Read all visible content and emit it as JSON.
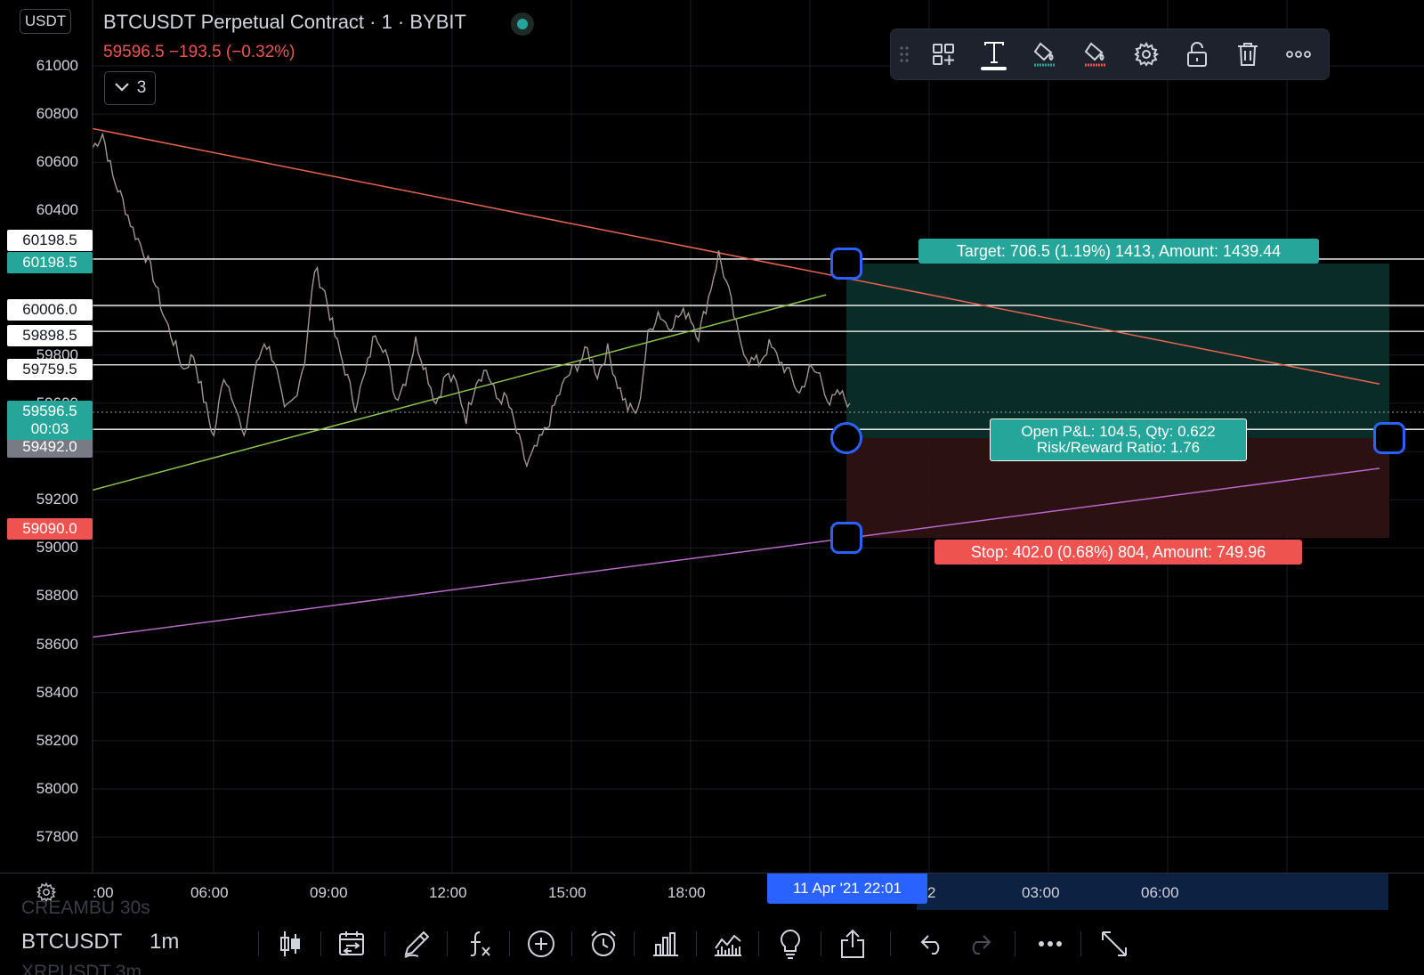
{
  "currency_badge": "USDT",
  "header": {
    "title": "BTCUSDT Perpetual Contract · 1 · BYBIT",
    "price_change": "59596.5 −193.5 (−0.32%)",
    "indicator_count": "3"
  },
  "colors": {
    "up": "#26a69a",
    "down": "#ef5350",
    "accent": "#2962ff",
    "background": "#000000",
    "toolbar_bg": "#1e222d"
  },
  "drawing_toolbar": {
    "icons": [
      "drag-grip-icon",
      "add-to-favorites-icon",
      "text-icon",
      "line-color-icon",
      "fill-color-icon",
      "settings-gear-icon",
      "unlock-icon",
      "trash-icon",
      "more-icon"
    ],
    "active": "text-icon"
  },
  "price_axis": {
    "ticks": [
      "61000",
      "60800",
      "60600",
      "60400",
      "60200",
      "60000",
      "59800",
      "59600",
      "59400",
      "59200",
      "59000",
      "58800",
      "58600",
      "58400",
      "58200",
      "58000",
      "57800"
    ],
    "labels": [
      {
        "value": "60198.5",
        "style": "white"
      },
      {
        "value": "60198.5",
        "style": "teal"
      },
      {
        "value": "60006.0",
        "style": "white"
      },
      {
        "value": "59898.5",
        "style": "white"
      },
      {
        "value": "59759.5",
        "style": "white"
      },
      {
        "value": "59492.0",
        "style": "grey"
      },
      {
        "value": "59090.0",
        "style": "red"
      }
    ],
    "current_price": "59596.5",
    "countdown": "00:03"
  },
  "position": {
    "target_text": "Target: 706.5 (1.19%) 1413, Amount: 1439.44",
    "stop_text": "Stop: 402.0 (0.68%) 804, Amount: 749.96",
    "pnl_line1": "Open P&L: 104.5, Qty: 0.622",
    "pnl_line2": "Risk/Reward Ratio: 1.76",
    "entry": 59492.0,
    "target": 60198.5,
    "stop": 59090.0
  },
  "time_axis": {
    "labels": [
      ":00",
      "06:00",
      "09:00",
      "12:00",
      "15:00",
      "18:00",
      "2",
      "03:00",
      "06:00"
    ],
    "cursor": "11 Apr '21   22:01"
  },
  "bottom_bar": {
    "ghost_above": "CREAMBU   30s",
    "symbol": "BTCUSDT",
    "interval": "1m",
    "ghost_below": "XRPUSDT   3m",
    "icons": [
      "candle-style-icon",
      "compare-calendar-icon",
      "drawing-pen-icon",
      "indicators-fx-icon",
      "add-circle-icon",
      "alarm-clock-icon",
      "bar-chart-icon",
      "line-chart-icon",
      "idea-lightbulb-icon",
      "share-icon",
      "undo-icon",
      "redo-icon",
      "more-dots-icon",
      "fullscreen-icon"
    ]
  },
  "chart_data": {
    "type": "line",
    "y_axis": {
      "min": 57700,
      "max": 61100
    },
    "x_labels": [
      ":00",
      "06:00",
      "09:00",
      "12:00",
      "15:00",
      "18:00",
      "2",
      "03:00",
      "06:00"
    ],
    "horizontal_levels": [
      60198.5,
      60006.0,
      59898.5,
      59759.5,
      59492.0
    ],
    "last_price": 59596.5,
    "price_series": [
      60660,
      60720,
      60540,
      60440,
      60320,
      60240,
      60130,
      59970,
      59860,
      59740,
      59800,
      59620,
      59460,
      59720,
      59620,
      59440,
      59720,
      59860,
      59780,
      59560,
      59620,
      59780,
      60160,
      60060,
      59880,
      59740,
      59590,
      59720,
      59900,
      59820,
      59620,
      59700,
      59860,
      59740,
      59600,
      59720,
      59680,
      59540,
      59700,
      59740,
      59620,
      59620,
      59480,
      59340,
      59420,
      59500,
      59620,
      59710,
      59760,
      59820,
      59720,
      59820,
      59680,
      59580,
      59560,
      59880,
      59980,
      59920,
      59960,
      59980,
      59880,
      60040,
      60220,
      60060,
      59870,
      59780,
      59770,
      59840,
      59780,
      59720,
      59640,
      59740,
      59720,
      59600,
      59640,
      59600
    ],
    "trendlines": [
      {
        "name": "",
        "color": "#e8654f",
        "from": [
          0,
          60740
        ],
        "to": [
          1,
          59680
        ]
      },
      {
        "name": "",
        "color": "#8bc34a",
        "from": [
          0,
          59240
        ],
        "to": [
          0.57,
          60050
        ]
      },
      {
        "name": "",
        "color": "#ba68c8",
        "from": [
          0,
          58630
        ],
        "to": [
          1,
          59330
        ]
      }
    ]
  }
}
